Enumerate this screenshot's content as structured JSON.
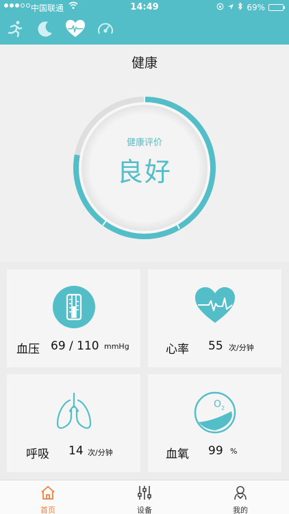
{
  "status_bar": {
    "carrier": "中国联通",
    "time": "14:49",
    "battery": "69%",
    "battery_level": 0.69
  },
  "mode_tabs": [
    {
      "icon": "running-icon"
    },
    {
      "icon": "moon-icon"
    },
    {
      "icon": "heart-monitor-icon",
      "active": true
    },
    {
      "icon": "gauge-icon"
    }
  ],
  "header": {
    "title": "健康"
  },
  "evaluation": {
    "label": "健康评价",
    "value": "良好"
  },
  "metrics": {
    "blood_pressure": {
      "label": "血压",
      "value": "69 / 110",
      "unit": "mmHg",
      "icon": "thermometer-icon"
    },
    "heart_rate": {
      "label": "心率",
      "value": "55",
      "unit": "次/分钟",
      "icon": "heart-rate-icon"
    },
    "respiration": {
      "label": "呼吸",
      "value": "14",
      "unit": "次/分钟",
      "icon": "lungs-icon"
    },
    "blood_oxygen": {
      "label": "血氧",
      "value": "99",
      "unit": "%",
      "icon": "oxygen-icon"
    }
  },
  "tabbar": [
    {
      "label": "首页",
      "icon": "home-icon",
      "active": true
    },
    {
      "label": "设备",
      "icon": "sliders-icon"
    },
    {
      "label": "我的",
      "icon": "profile-icon"
    }
  ],
  "colors": {
    "accent": "#54bec8",
    "active_tab": "#f07f3c"
  }
}
